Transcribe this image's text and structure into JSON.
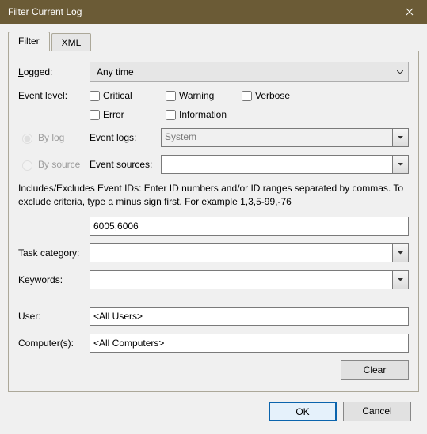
{
  "window": {
    "title": "Filter Current Log"
  },
  "tabs": {
    "filter": "Filter",
    "xml": "XML"
  },
  "labels": {
    "logged": "Logged:",
    "event_level": "Event level:",
    "by_log": "By log",
    "by_source": "By source",
    "event_logs": "Event logs:",
    "event_sources": "Event sources:",
    "task_category": "Task category:",
    "keywords": "Keywords:",
    "user": "User:",
    "computers": "Computer(s):"
  },
  "values": {
    "logged": "Any time",
    "event_logs": "System",
    "event_ids": "6005,6006",
    "user": "<All Users>",
    "computers": "<All Computers>"
  },
  "checkboxes": {
    "critical": "Critical",
    "warning": "Warning",
    "verbose": "Verbose",
    "error": "Error",
    "information": "Information"
  },
  "help": "Includes/Excludes Event IDs: Enter ID numbers and/or ID ranges separated by commas. To exclude criteria, type a minus sign first. For example 1,3,5-99,-76",
  "buttons": {
    "clear": "Clear",
    "ok": "OK",
    "cancel": "Cancel"
  }
}
